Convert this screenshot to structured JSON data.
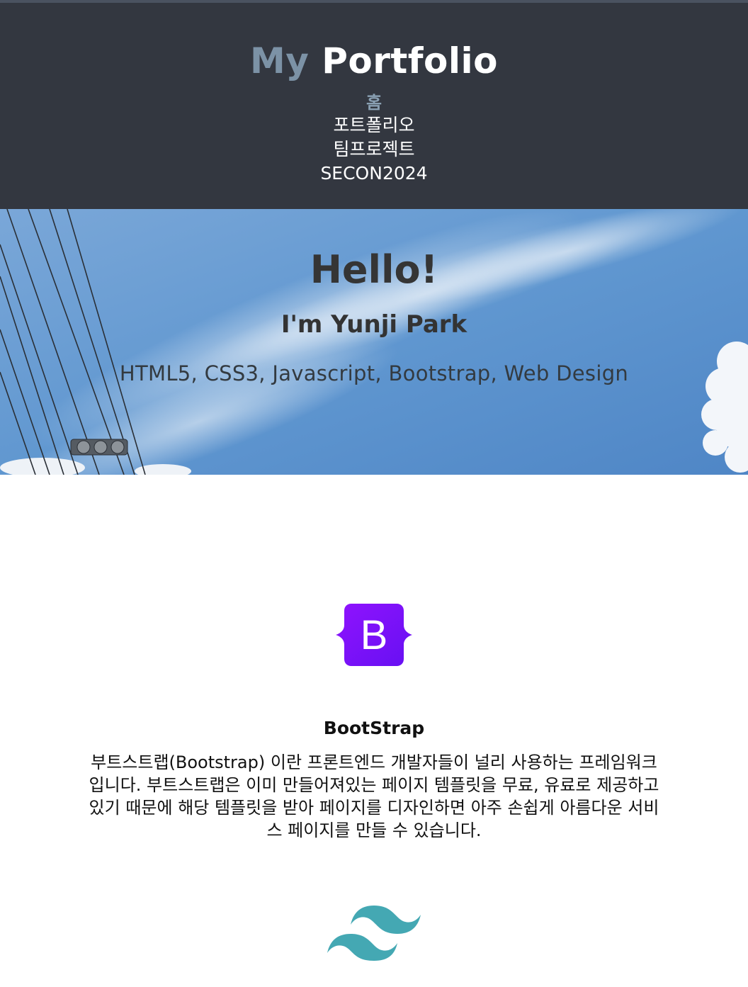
{
  "header": {
    "brand_first": "My",
    "brand_rest": "Portfolio",
    "nav": [
      "홈",
      "포트폴리오",
      "팀프로젝트",
      "SECON2024"
    ]
  },
  "hero": {
    "title": "Hello!",
    "subtitle": "I'm Yunji Park",
    "skills": "HTML5, CSS3, Javascript, Bootstrap, Web Design"
  },
  "skills": [
    {
      "name": "BootStrap",
      "icon": "bootstrap-logo-icon",
      "logo_letter": "B",
      "description": "부트스트랩(Bootstrap) 이란 프론트엔드 개발자들이 널리 사용하는 프레임워크입니다. 부트스트랩은 이미 만들어져있는 페이지 템플릿을 무료, 유료로 제공하고 있기 때문에 해당 템플릿을 받아 페이지를 디자인하면 아주 손쉽게 아름다운 서비스 페이지를 만들 수 있습니다."
    },
    {
      "icon": "tailwind-logo-icon"
    }
  ],
  "colors": {
    "header_bg": "#333740",
    "brand_accent": "#7c92a6",
    "bootstrap_purple": "#7a14f5",
    "tailwind_teal": "#44a8b3"
  }
}
